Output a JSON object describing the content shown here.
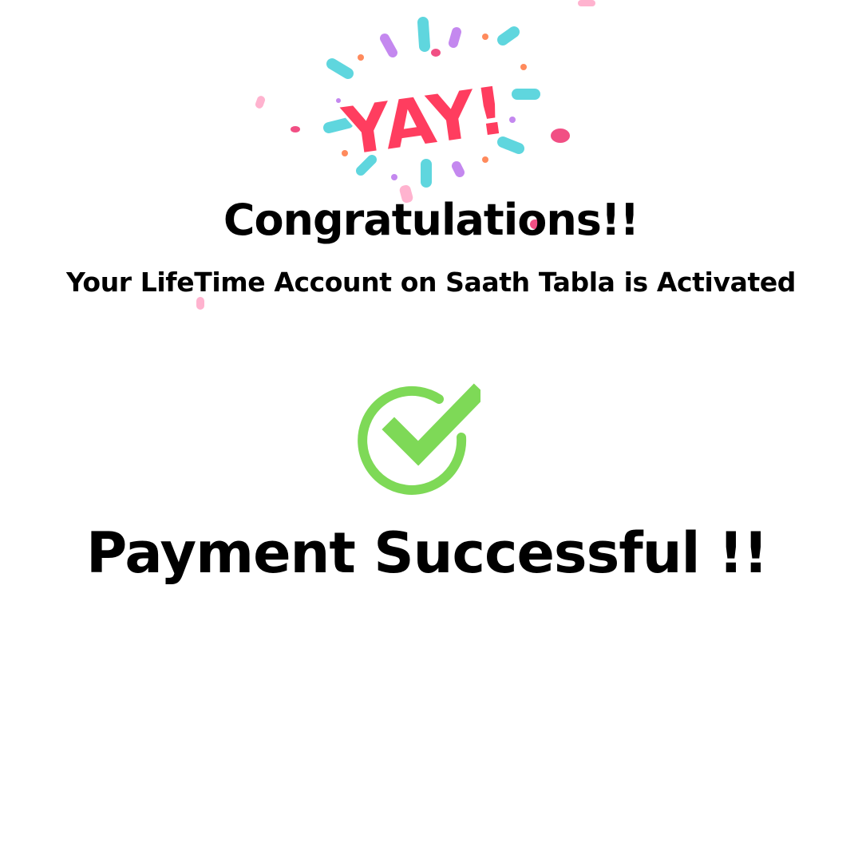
{
  "celebration": {
    "yay_text": "YAY!",
    "colors": {
      "yay": "#ff3d5f",
      "cyan": "#5fd6de",
      "purple": "#c488ef",
      "orange": "#ff8a5c",
      "pink": "#ffb3cf"
    }
  },
  "header": {
    "title": "Congratulations!!",
    "subtitle": "Your LifeTime Account on Saath Tabla is Activated"
  },
  "status": {
    "icon": "check-circle-icon",
    "icon_color": "#7ed957",
    "message": "Payment Successful !!"
  }
}
